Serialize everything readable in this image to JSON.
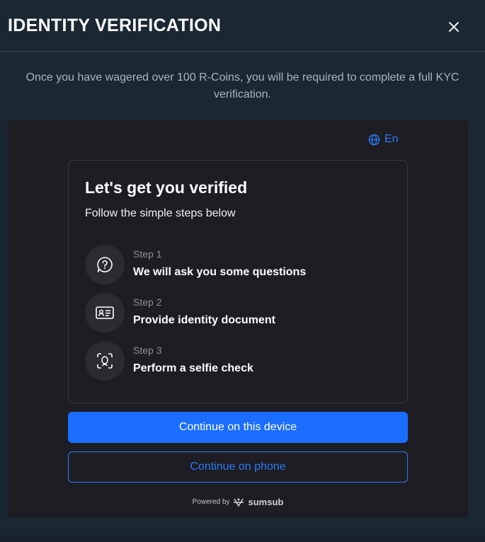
{
  "modal": {
    "title": "IDENTITY VERIFICATION",
    "close_icon": "close-icon",
    "notice": "Once you have wagered over 100 R-Coins, you will be required to complete a full KYC verification."
  },
  "widget": {
    "language": "En",
    "card": {
      "title": "Let's get you verified",
      "subtitle": "Follow the simple steps below",
      "steps": [
        {
          "label": "Step 1",
          "description": "We will ask you some questions",
          "icon": "question-bubble-icon"
        },
        {
          "label": "Step 2",
          "description": "Provide identity document",
          "icon": "id-card-icon"
        },
        {
          "label": "Step 3",
          "description": "Perform a selfie check",
          "icon": "face-scan-icon"
        }
      ]
    },
    "primary_button": "Continue on this device",
    "secondary_button": "Continue on phone",
    "powered_by": "Powered by",
    "brand": "sumsub"
  },
  "colors": {
    "modal_bg": "#1b2733",
    "widget_bg": "#1d1d23",
    "accent": "#1a6dff",
    "link": "#2b7bf6"
  }
}
